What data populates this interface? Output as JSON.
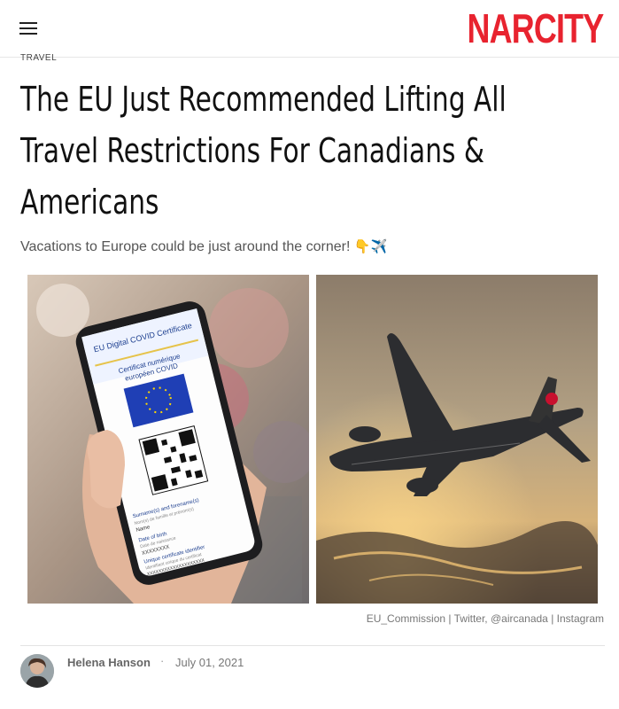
{
  "brand": {
    "logo": "NARCITY",
    "accent": "#e8232f"
  },
  "header": {
    "menu_icon": "hamburger-icon"
  },
  "article": {
    "category": "TRAVEL",
    "headline_lines": [
      "The EU Just Recommended Lifting All",
      "Travel Restrictions For Canadians &",
      "Americans"
    ],
    "subtitle": "Vacations to Europe could be just around the corner!",
    "subtitle_emoji": "👇✈️",
    "image_left": {
      "phone_title": "EU Digital COVID Certificate",
      "phone_subtitle_1": "Certificat numérique",
      "phone_subtitle_2": "européen COVID",
      "field_1": "Surname(s) and forename(s)",
      "field_1_sub": "Nom(s) de famille et prénom(s)",
      "field_1_val": "Name",
      "field_2": "Date of birth",
      "field_2_sub": "Date de naissance",
      "field_2_val": "XXXXXXXX",
      "field_3": "Unique certificate identifier",
      "field_3_sub": "Identifiant unique du certificat",
      "field_3_val": "XXXXXXXXXXXXXXXXXXXX"
    },
    "image_credit": "EU_Commission | Twitter, @aircanada | Instagram",
    "author": "Helena Hanson",
    "separator": "·",
    "date": "July 01, 2021"
  }
}
